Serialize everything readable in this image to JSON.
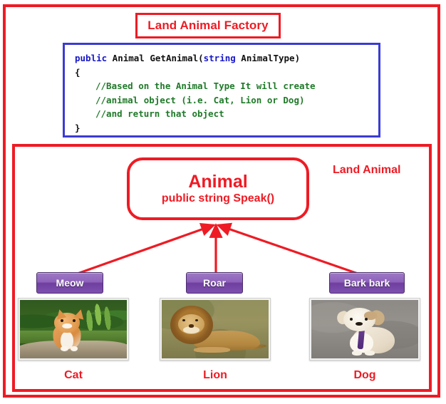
{
  "diagram": {
    "title": "Land Animal Factory",
    "group_label": "Land Animal",
    "accent_color": "#ee1b24",
    "code_border_color": "#3b3bd4",
    "bubble_color": "#7e50ae"
  },
  "code": {
    "line1_kw": "public",
    "line1_rest": " Animal GetAnimal(",
    "line1_kw2": "string",
    "line1_end": " AnimalType)",
    "line2": "{",
    "comment1": "//Based on the Animal Type It will create",
    "comment2": "//animal object (i.e. Cat, Lion or Dog)",
    "comment3": "//and return that object",
    "line6": "}"
  },
  "base_class": {
    "name": "Animal",
    "method": "public string Speak()"
  },
  "animals": [
    {
      "name": "Cat",
      "sound": "Meow",
      "image_name": "cat-photo"
    },
    {
      "name": "Lion",
      "sound": "Roar",
      "image_name": "lion-photo"
    },
    {
      "name": "Dog",
      "sound": "Bark bark",
      "image_name": "dog-photo"
    }
  ]
}
